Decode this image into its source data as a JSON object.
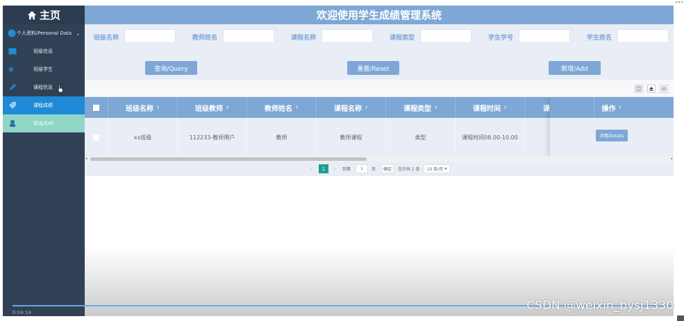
{
  "sidebar": {
    "home_label": "主页",
    "items": [
      {
        "label": "个人资料/Personal Data",
        "chevron": "⌄"
      },
      {
        "label": "班级信息"
      },
      {
        "label": "班级学生"
      },
      {
        "label": "课程信息"
      },
      {
        "label": "课程成绩"
      },
      {
        "label": "退出/Exit"
      }
    ],
    "timestamp": "0:04:14"
  },
  "header": {
    "title": "欢迎使用学生成绩管理系统"
  },
  "search": {
    "labels": [
      "班级名称",
      "教师姓名",
      "课程名称",
      "课程类型",
      "学生学号",
      "学生姓名"
    ],
    "query_button": "查询/Query",
    "reset_button": "重置/Reset",
    "add_button": "新增/Add"
  },
  "table": {
    "columns": [
      "班级名称",
      "班级教师",
      "教师姓名",
      "课程名称",
      "课程类型",
      "课程时间",
      "课"
    ],
    "sort_glyph": "⇕",
    "rows": [
      [
        "xx班级",
        "112233-教师用户",
        "教师",
        "教师课程",
        "类型",
        "课程时间08.00-10.00",
        ""
      ]
    ],
    "op_header": "操作",
    "detail_button": "详情/Details"
  },
  "pagination": {
    "prev": "‹",
    "current_page": "1",
    "next": "›",
    "goto_label": "到第",
    "goto_value": "1",
    "page_unit": "页",
    "confirm": "确定",
    "total": "合计共 1 条",
    "page_size": "10 条/页"
  },
  "watermark": "CSDN @weixin_bysj1330",
  "colors": {
    "accent": "#7ea7d6",
    "sidebar": "#304156",
    "active": "#1f8bd6",
    "exit": "#8fd6c7",
    "page_current": "#1aa094"
  }
}
